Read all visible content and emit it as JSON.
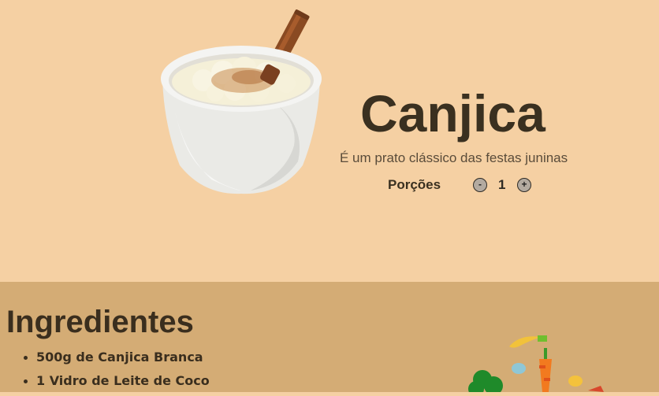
{
  "recipe": {
    "title": "Canjica",
    "subtitle": "É um prato clássico das festas juninas",
    "image_icon": "rice-pudding-bowl-image"
  },
  "portions": {
    "label": "Porções",
    "value": "1",
    "decrement_label": "-",
    "increment_label": "+"
  },
  "ingredients": {
    "title": "Ingredientes",
    "items": [
      "500g de Canjica Branca",
      "1 Vidro de Leite de Coco"
    ],
    "illustration_icon": "vegetables-illustration"
  },
  "colors": {
    "hero_background": "#f5d0a3",
    "ingredients_background": "#d4ac75",
    "text_dark": "#3a3020"
  }
}
